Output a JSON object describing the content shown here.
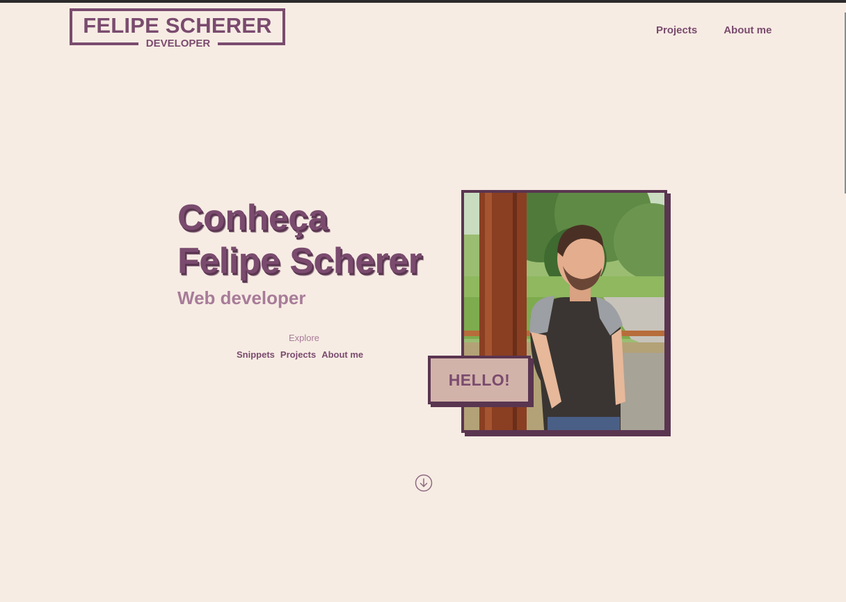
{
  "logo": {
    "title": "FELIPE SCHERER",
    "subtitle": "DEVELOPER"
  },
  "nav": {
    "items": [
      {
        "label": "Projects"
      },
      {
        "label": "About me"
      }
    ]
  },
  "hero": {
    "title_line1": "Conheça",
    "title_line2": "Felipe Scherer",
    "role": "Web developer",
    "explore_label": "Explore",
    "explore_links": [
      {
        "label": "Snippets"
      },
      {
        "label": "Projects"
      },
      {
        "label": "About me"
      }
    ],
    "badge": "HELLO!"
  },
  "icons": {
    "scroll": "arrow-down-circle-icon"
  },
  "colors": {
    "background": "#f7ece4",
    "accent": "#7a4b6e",
    "accent_dark": "#5a3550",
    "accent_light": "#a77c98",
    "badge_bg": "#d2b3aa"
  }
}
